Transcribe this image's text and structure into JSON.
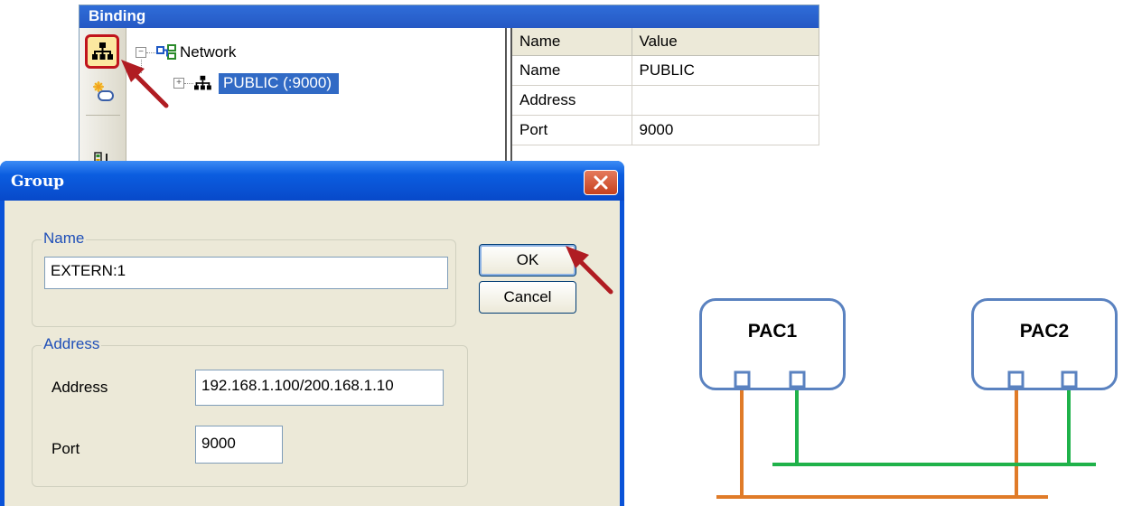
{
  "binding": {
    "title": "Binding",
    "tree": {
      "root_label": "Network",
      "child_label": "PUBLIC (:9000)"
    },
    "properties": {
      "headers": [
        "Name",
        "Value"
      ],
      "rows": [
        {
          "name": "Name",
          "value": "PUBLIC"
        },
        {
          "name": "Address",
          "value": ""
        },
        {
          "name": "Port",
          "value": "9000"
        }
      ]
    },
    "toolbar_icons": [
      "network-add-icon",
      "group-add-icon",
      "sort-icon"
    ]
  },
  "dialog": {
    "title": "Group",
    "name_group": {
      "legend": "Name",
      "value": "EXTERN:1"
    },
    "address_group": {
      "legend": "Address",
      "address_label": "Address",
      "address_value": "192.168.1.100/200.168.1.10",
      "port_label": "Port",
      "port_value": "9000"
    },
    "ok_label": "OK",
    "cancel_label": "Cancel"
  },
  "diagram": {
    "pac1_label": "PAC1",
    "pac2_label": "PAC2",
    "colors": {
      "orange_line": "#e07b28",
      "green_line": "#1fb24a",
      "box_border": "#5a82c0"
    }
  },
  "annotations": {
    "arrow_color": "#b01c22"
  }
}
